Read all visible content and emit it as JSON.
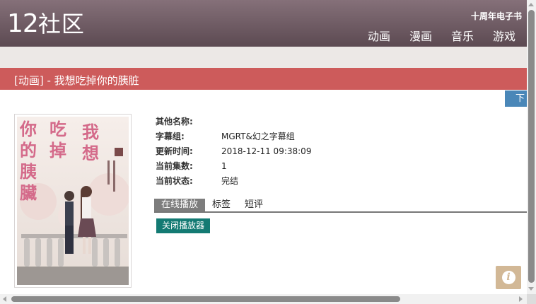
{
  "header": {
    "logo_num": "12",
    "logo_text": "社区",
    "anniversary": "十周年电子书",
    "nav": [
      "动画",
      "漫画",
      "音乐",
      "游戏"
    ]
  },
  "page_title": "[动画] - 我想吃掉你的胰脏",
  "download_label": "下",
  "cover": {
    "title_line1": "我想",
    "title_line2": "吃掉",
    "title_line3": "你的",
    "title_line4": "胰臟"
  },
  "info": [
    {
      "key": "其他名称:",
      "value": ""
    },
    {
      "key": "字幕组:",
      "value": "MGRT&幻之字幕组"
    },
    {
      "key": "更新时间:",
      "value": "2018-12-11 09:38:09"
    },
    {
      "key": "当前集数:",
      "value": "1"
    },
    {
      "key": "当前状态:",
      "value": "完结"
    }
  ],
  "tabs": [
    "在线播放",
    "标签",
    "短评"
  ],
  "close_player_label": "关闭播放器",
  "info_icon": "i",
  "colors": {
    "header": "#6b5a62",
    "title_bar": "#cd5b5b",
    "button": "#137a73",
    "download": "#4a87b8",
    "info_icon": "#d2b896"
  }
}
